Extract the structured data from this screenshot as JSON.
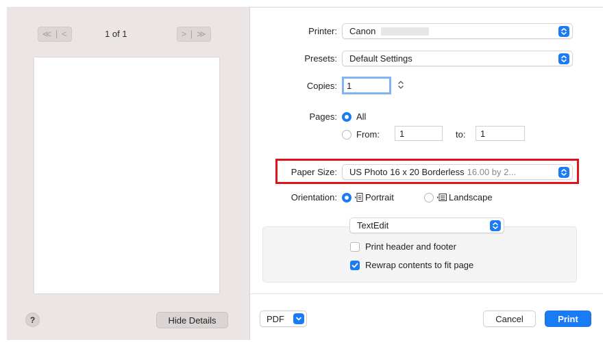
{
  "preview": {
    "prev_label": "≪ | <",
    "next_label": "> | ≫",
    "page_count": "1 of 1",
    "help_label": "?",
    "hide_details_label": "Hide Details"
  },
  "printer": {
    "label": "Printer:",
    "value": "Canon"
  },
  "presets": {
    "label": "Presets:",
    "value": "Default Settings"
  },
  "copies": {
    "label": "Copies:",
    "value": "1"
  },
  "pages": {
    "label": "Pages:",
    "all_label": "All",
    "from_label": "From:",
    "from_value": "1",
    "to_label": "to:",
    "to_value": "1",
    "selected": "All"
  },
  "paper_size": {
    "label": "Paper Size:",
    "value": "US Photo 16 x 20 Borderless",
    "dims": "16.00 by 2..."
  },
  "orientation": {
    "label": "Orientation:",
    "portrait_label": "Portrait",
    "landscape_label": "Landscape",
    "selected": "Portrait"
  },
  "app_section": {
    "popup_value": "TextEdit",
    "print_header_footer_label": "Print header and footer",
    "print_header_footer_checked": false,
    "rewrap_label": "Rewrap contents to fit page",
    "rewrap_checked": true
  },
  "footer": {
    "pdf_label": "PDF",
    "cancel_label": "Cancel",
    "print_label": "Print"
  },
  "colors": {
    "accent": "#1a7cf5",
    "highlight": "#e0131d",
    "sidebar_bg": "#ece5e5"
  }
}
